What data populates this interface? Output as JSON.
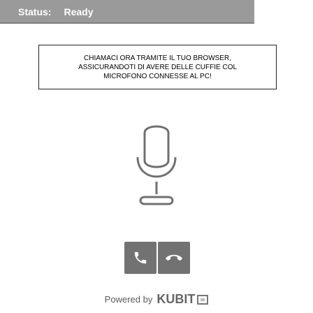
{
  "status_bar": {
    "label": "Status:",
    "value": "Ready"
  },
  "notice": {
    "text": "CHIAMACI ORA TRAMITE IL TUO BROWSER,\nASSICURANDOTI DI AVERE DELLE CUFFIE COL\nMICROFONO CONNESSE AL PC!"
  },
  "icons": {
    "microphone": "microphone-icon",
    "call": "phone-icon",
    "hangup": "hangup-icon"
  },
  "footer": {
    "powered_label": "Powered by",
    "brand_name": "KUBIT",
    "brand_logo": "kubit-logo"
  },
  "colors": {
    "status_bg": "#9a9a9a",
    "button_bg": "#727272",
    "icon_fill": "#ffffff",
    "mic_stroke": "#707070"
  }
}
